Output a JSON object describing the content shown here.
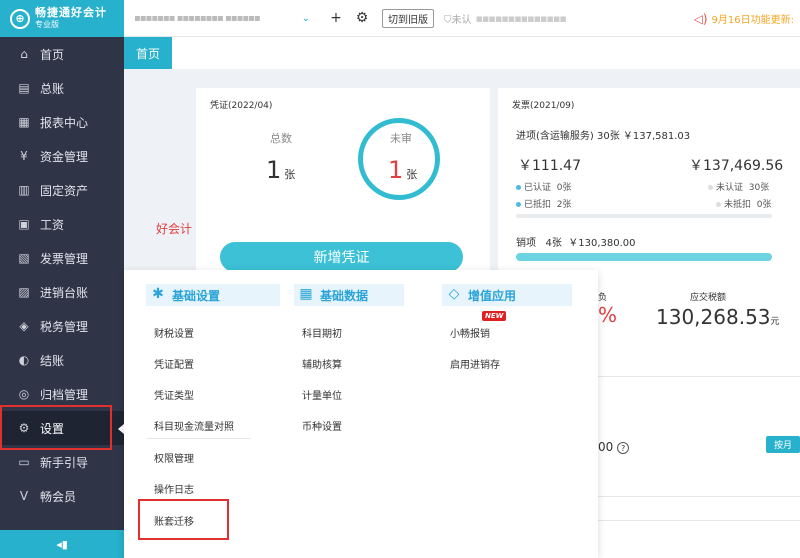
{
  "app": {
    "logo_mark": "⊕",
    "name": "畅捷通好会计",
    "edition": "专业版"
  },
  "sidebar": {
    "items": [
      {
        "label": "首页",
        "icon": "home-icon",
        "glyph": "⌂"
      },
      {
        "label": "总账",
        "icon": "ledger-icon",
        "glyph": "▤"
      },
      {
        "label": "报表中心",
        "icon": "chart-icon",
        "glyph": "▦"
      },
      {
        "label": "资金管理",
        "icon": "money-icon",
        "glyph": "¥"
      },
      {
        "label": "固定资产",
        "icon": "building-icon",
        "glyph": "▥"
      },
      {
        "label": "工资",
        "icon": "wallet-icon",
        "glyph": "▣"
      },
      {
        "label": "发票管理",
        "icon": "invoice-icon",
        "glyph": "▧"
      },
      {
        "label": "进销台账",
        "icon": "book-icon",
        "glyph": "▨"
      },
      {
        "label": "税务管理",
        "icon": "tax-icon",
        "glyph": "◈"
      },
      {
        "label": "结账",
        "icon": "close-books-icon",
        "glyph": "◐"
      },
      {
        "label": "归档管理",
        "icon": "archive-icon",
        "glyph": "◎"
      },
      {
        "label": "设置",
        "icon": "gear-icon",
        "glyph": "⚙"
      },
      {
        "label": "新手引导",
        "icon": "guide-icon",
        "glyph": "▭"
      },
      {
        "label": "畅会员",
        "icon": "vip-icon",
        "glyph": "V"
      }
    ],
    "collapse_glyph": "◂▮"
  },
  "topbar": {
    "company_name": "▪▪▪▪▪▪▪ ▪▪▪▪▪▪▪▪ ▪▪▪▪▪▪",
    "dropdown_glyph": "⌄",
    "add_glyph": "+",
    "settings_glyph": "⚙",
    "old_version_label": "切到旧版",
    "auth_label": "⛉未认",
    "auth_blurred": "▪▪▪▪▪▪▪▪▪▪▪▪▪▪",
    "speaker_glyph": "◁)",
    "notice": "9月16日功能更新:"
  },
  "tabs": {
    "home": "首页"
  },
  "voucher": {
    "title": "凭证(2022/04)",
    "total_label": "总数",
    "total_value": "1",
    "pending_label": "未审",
    "pending_value": "1",
    "unit": "张",
    "new_voucher_label": "新增凭证",
    "side_text": "好会计"
  },
  "invoice": {
    "title": "发票(2021/09)",
    "input_summary": "进项(含运输服务) 30张 ￥137,581.03",
    "certified_amount": "￥111.47",
    "uncertified_amount": "￥137,469.56",
    "certified_label": "已认证",
    "certified_count": "0张",
    "uncertified_label": "未认证",
    "uncertified_count": "30张",
    "deducted_label": "已抵扣",
    "deducted_count": "2张",
    "undeducted_label": "未抵扣",
    "undeducted_count": "0张",
    "output_label": "销项",
    "output_count": "4张",
    "output_amount": "￥130,380.00",
    "output_bar_fill": 1.0
  },
  "tax": {
    "left_label_partial": "负",
    "pct_partial": "%",
    "payable_label": "应交税额",
    "payable_value": "130,268.53",
    "payable_unit": "元"
  },
  "lower": {
    "partial_number": "00",
    "info_glyph": "?",
    "by_month_label": "按月"
  },
  "settings_menu": {
    "basic": {
      "title": "基础设置",
      "icon_glyph": "✱",
      "items": [
        "财税设置",
        "凭证配置",
        "凭证类型",
        "科目现金流量对照",
        "权限管理",
        "操作日志",
        "账套迁移"
      ]
    },
    "data": {
      "title": "基础数据",
      "icon_glyph": "▦",
      "items": [
        "科目期初",
        "辅助核算",
        "计量单位",
        "币种设置"
      ]
    },
    "apps": {
      "title": "增值应用",
      "icon_glyph": "◇",
      "new_badge": "NEW",
      "items": [
        "小畅报销",
        "启用进销存"
      ]
    }
  }
}
